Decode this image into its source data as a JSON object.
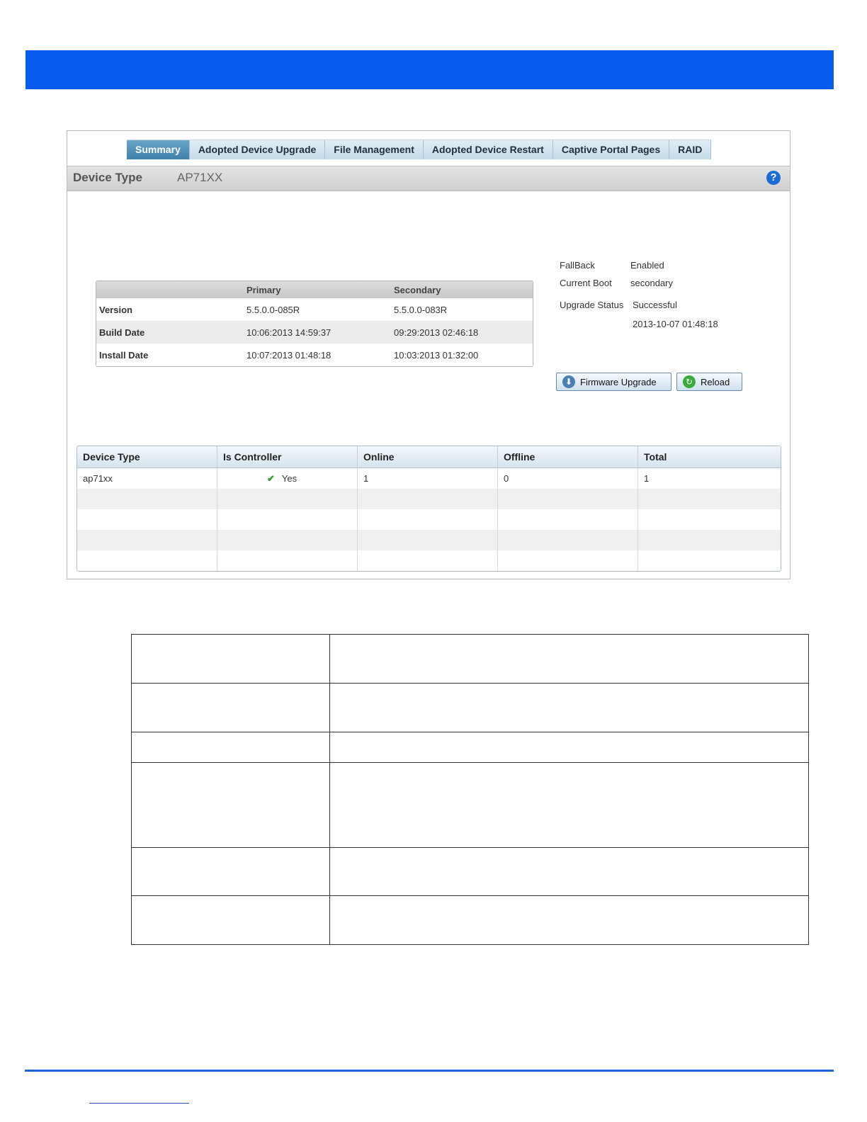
{
  "tabs": [
    {
      "label": "Summary",
      "active": true
    },
    {
      "label": "Adopted Device Upgrade",
      "active": false
    },
    {
      "label": "File Management",
      "active": false
    },
    {
      "label": "Adopted Device Restart",
      "active": false
    },
    {
      "label": "Captive Portal Pages",
      "active": false
    },
    {
      "label": "RAID",
      "active": false
    }
  ],
  "device_bar": {
    "label": "Device Type",
    "value": "AP71XX",
    "help_icon": "?"
  },
  "firmware_table": {
    "headers": [
      "",
      "Primary",
      "Secondary"
    ],
    "rows": [
      {
        "label": "Version",
        "primary": "5.5.0.0-085R",
        "secondary": "5.5.0.0-083R"
      },
      {
        "label": "Build Date",
        "primary": "10:06:2013 14:59:37",
        "secondary": "09:29:2013 02:46:18"
      },
      {
        "label": "Install Date",
        "primary": "10:07:2013 01:48:18",
        "secondary": "10:03:2013 01:32:00"
      }
    ]
  },
  "status": {
    "fallback_label": "FallBack",
    "fallback_value": "Enabled",
    "current_boot_label": "Current Boot",
    "current_boot_value": "secondary",
    "upgrade_status_label": "Upgrade Status",
    "upgrade_status_value": "Successful",
    "upgrade_time": "2013-10-07 01:48:18"
  },
  "buttons": {
    "firmware_upgrade": "Firmware Upgrade",
    "reload": "Reload"
  },
  "device_table": {
    "headers": [
      "Device Type",
      "Is Controller",
      "Online",
      "Offline",
      "Total"
    ],
    "rows": [
      {
        "device_type": "ap71xx",
        "is_controller": "Yes",
        "online": "1",
        "offline": "0",
        "total": "1"
      }
    ]
  },
  "colors": {
    "header_bar": "#0a5cf0",
    "active_tab": "#3e81ad",
    "footer_line": "#1f62d8"
  }
}
